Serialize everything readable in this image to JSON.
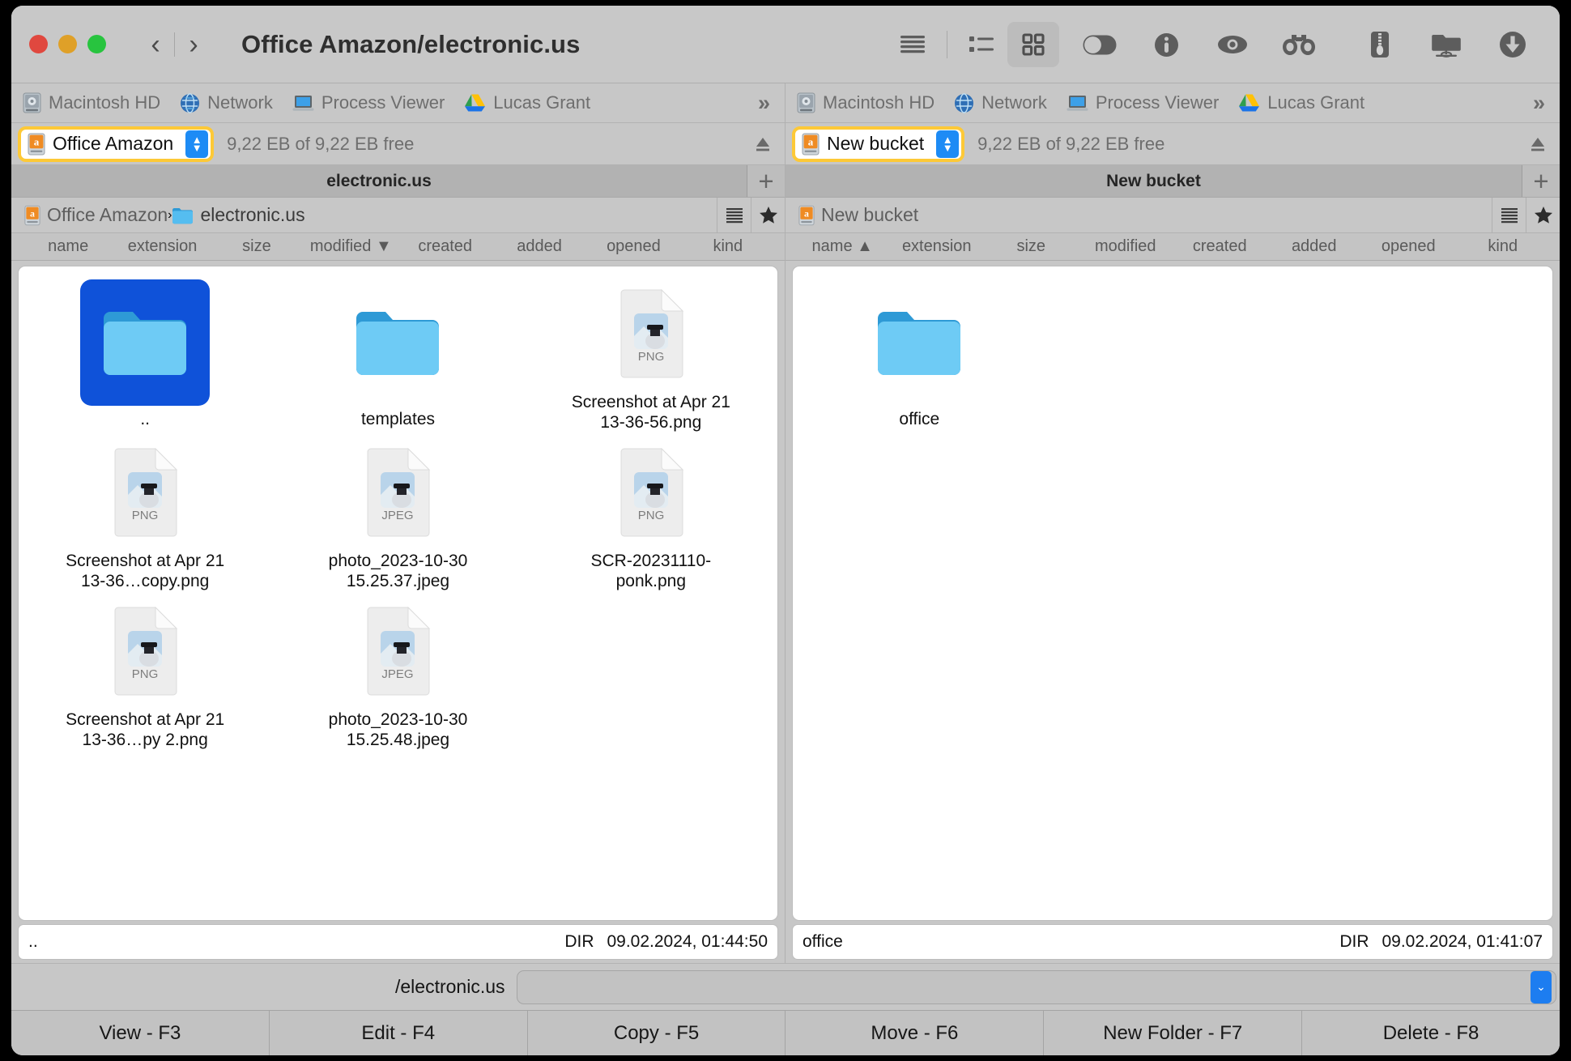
{
  "window": {
    "title": "Office Amazon/electronic.us",
    "traffic": {
      "close": "close-button",
      "minimize": "minimize-button",
      "maximize": "maximize-button"
    },
    "nav": {
      "back": "‹",
      "forward": "›"
    }
  },
  "toolbar": {
    "items": [
      {
        "name": "sidebar-toggle-icon",
        "label": "Sidebar"
      },
      {
        "name": "list-view-icon",
        "label": "List view"
      },
      {
        "name": "grid-view-icon",
        "label": "Grid view",
        "active": true
      },
      {
        "name": "toggle-switch-icon",
        "label": "Toggle"
      },
      {
        "name": "info-icon",
        "label": "Info"
      },
      {
        "name": "eye-icon",
        "label": "Preview"
      },
      {
        "name": "binoculars-icon",
        "label": "Find"
      },
      {
        "name": "archive-zip-icon",
        "label": "Archive"
      },
      {
        "name": "network-folder-icon",
        "label": "Connect to server"
      },
      {
        "name": "download-icon",
        "label": "Download"
      }
    ]
  },
  "favorites": [
    {
      "label": "Macintosh HD",
      "icon": "hard-drive-icon"
    },
    {
      "label": "Network",
      "icon": "globe-icon"
    },
    {
      "label": "Process Viewer",
      "icon": "laptop-icon"
    },
    {
      "label": "Lucas Grant",
      "icon": "google-drive-icon"
    }
  ],
  "favorites_more": "»",
  "left": {
    "drive": {
      "name": "Office Amazon",
      "icon": "amazon-drive-icon",
      "free": "9,22 EB of 9,22 EB free"
    },
    "tab": "electronic.us",
    "tab_add": "+",
    "breadcrumb": [
      {
        "label": "Office Amazon",
        "icon": "amazon-drive-icon"
      },
      {
        "label": "electronic.us",
        "icon": "folder-icon"
      }
    ],
    "breadcrumb_sep": "›",
    "columns": [
      {
        "label": "name"
      },
      {
        "label": "extension"
      },
      {
        "label": "size"
      },
      {
        "label": "modified",
        "sorted": true,
        "direction": "▼"
      },
      {
        "label": "created"
      },
      {
        "label": "added"
      },
      {
        "label": "opened"
      },
      {
        "label": "kind"
      }
    ],
    "files": [
      {
        "name": "..",
        "type": "folder",
        "selected": true
      },
      {
        "name": "templates",
        "type": "folder",
        "selected": false
      },
      {
        "name": "Screenshot at Apr 21 13-36-56.png",
        "type": "image",
        "badge": "PNG",
        "selected": false
      },
      {
        "name": "Screenshot at Apr 21 13-36…copy.png",
        "type": "image",
        "badge": "PNG",
        "selected": false
      },
      {
        "name": "photo_2023-10-30 15.25.37.jpeg",
        "type": "image",
        "badge": "JPEG",
        "selected": false
      },
      {
        "name": "SCR-20231110-ponk.png",
        "type": "image",
        "badge": "PNG",
        "selected": false
      },
      {
        "name": "Screenshot at Apr 21 13-36…py 2.png",
        "type": "image",
        "badge": "PNG",
        "selected": false
      },
      {
        "name": "photo_2023-10-30 15.25.48.jpeg",
        "type": "image",
        "badge": "JPEG",
        "selected": false
      }
    ],
    "status": {
      "name": "..",
      "kind": "DIR",
      "date": "09.02.2024, 01:44:50"
    }
  },
  "right": {
    "drive": {
      "name": "New bucket",
      "icon": "amazon-drive-icon",
      "free": "9,22 EB of 9,22 EB free"
    },
    "tab": "New bucket",
    "tab_add": "+",
    "breadcrumb": [
      {
        "label": "New bucket",
        "icon": "amazon-drive-icon"
      }
    ],
    "columns": [
      {
        "label": "name",
        "sorted": true,
        "direction": "▲"
      },
      {
        "label": "extension"
      },
      {
        "label": "size"
      },
      {
        "label": "modified"
      },
      {
        "label": "created"
      },
      {
        "label": "added"
      },
      {
        "label": "opened"
      },
      {
        "label": "kind"
      }
    ],
    "files": [
      {
        "name": "office",
        "type": "folder",
        "selected": false
      }
    ],
    "status": {
      "name": "office",
      "kind": "DIR",
      "date": "09.02.2024, 01:41:07"
    }
  },
  "command": {
    "prompt": "/electronic.us",
    "value": "",
    "placeholder": "",
    "dropdown": "⌄"
  },
  "function_keys": [
    {
      "label": "View - F3"
    },
    {
      "label": "Edit - F4"
    },
    {
      "label": "Copy - F5"
    },
    {
      "label": "Move - F6"
    },
    {
      "label": "New Folder - F7"
    },
    {
      "label": "Delete - F8"
    }
  ],
  "colors": {
    "accent_blue": "#1d8bf5",
    "selection_blue": "#0f52d9",
    "highlight_yellow": "#fdc937",
    "folder_blue": "#53bdf0",
    "chrome_gray": "#c7c7c7"
  }
}
